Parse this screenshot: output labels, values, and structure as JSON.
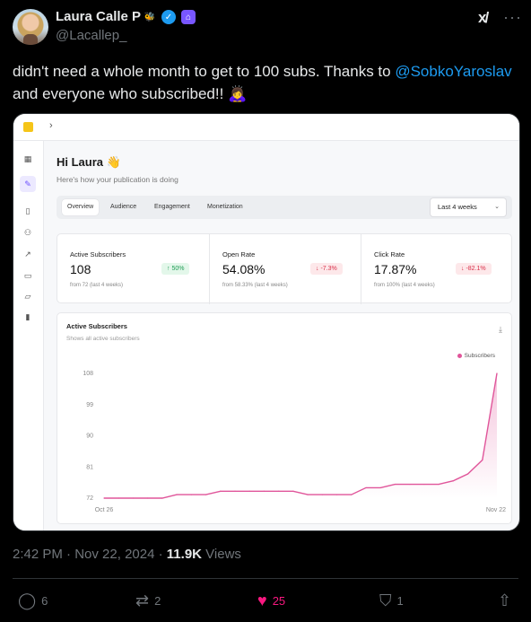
{
  "tweet": {
    "author_name": "Laura Calle P",
    "handle": "@Lacallep_",
    "text_before": "didn't need a whole month to get to 100 subs. Thanks to ",
    "mention": "@SobkoYaroslav",
    "text_after": " and everyone who subscribed!! 🙇‍♀️",
    "time": "2:42 PM",
    "date": "Nov 22, 2024",
    "views_count": "11.9K",
    "views_label": "Views",
    "replies": "6",
    "reposts": "2",
    "likes": "25",
    "bookmarks": "1",
    "colors": {
      "accent": "#1d9bf0",
      "like": "#f91880",
      "background": "#000000"
    },
    "icons": [
      "bee-badge-icon",
      "verified-icon",
      "home-badge-icon",
      "grok-icon",
      "more-icon",
      "reply-icon",
      "repost-icon",
      "like-icon",
      "bookmark-icon",
      "share-icon"
    ]
  },
  "dashboard": {
    "greeting": "Hi Laura 👋",
    "subgreeting": "Here's how your publication is doing",
    "tabs": [
      {
        "label": "Overview",
        "active": true
      },
      {
        "label": "Audience",
        "active": false
      },
      {
        "label": "Engagement",
        "active": false
      },
      {
        "label": "Monetization",
        "active": false
      }
    ],
    "period": "Last 4 weeks",
    "stats": [
      {
        "label": "Active Subscribers",
        "value": "108",
        "delta": "↑ 50%",
        "direction": "up",
        "sub": "from 72 (last 4 weeks)"
      },
      {
        "label": "Open Rate",
        "value": "54.08%",
        "delta": "↓ -7.3%",
        "direction": "down",
        "sub": "from 58.33% (last 4 weeks)"
      },
      {
        "label": "Click Rate",
        "value": "17.87%",
        "delta": "↓ -82.1%",
        "direction": "down",
        "sub": "from 100% (last 4 weeks)"
      }
    ],
    "chart_card": {
      "title": "Active Subscribers",
      "subtitle": "Shows all active subscribers",
      "legend": "Subscribers"
    }
  },
  "chart_data": {
    "type": "area",
    "title": "Active Subscribers",
    "series": [
      {
        "name": "Subscribers",
        "color": "#e0559a",
        "values": [
          72,
          72,
          72,
          72,
          72,
          73,
          73,
          73,
          74,
          74,
          74,
          74,
          74,
          74,
          73,
          73,
          73,
          73,
          75,
          75,
          76,
          76,
          76,
          76,
          77,
          79,
          83,
          108
        ]
      }
    ],
    "x_start_label": "Oct 26",
    "x_end_label": "Nov 22",
    "ylim": [
      72,
      108
    ],
    "yticks": [
      72,
      81,
      90,
      99,
      108
    ],
    "grid": false,
    "legend_position": "top-right"
  }
}
